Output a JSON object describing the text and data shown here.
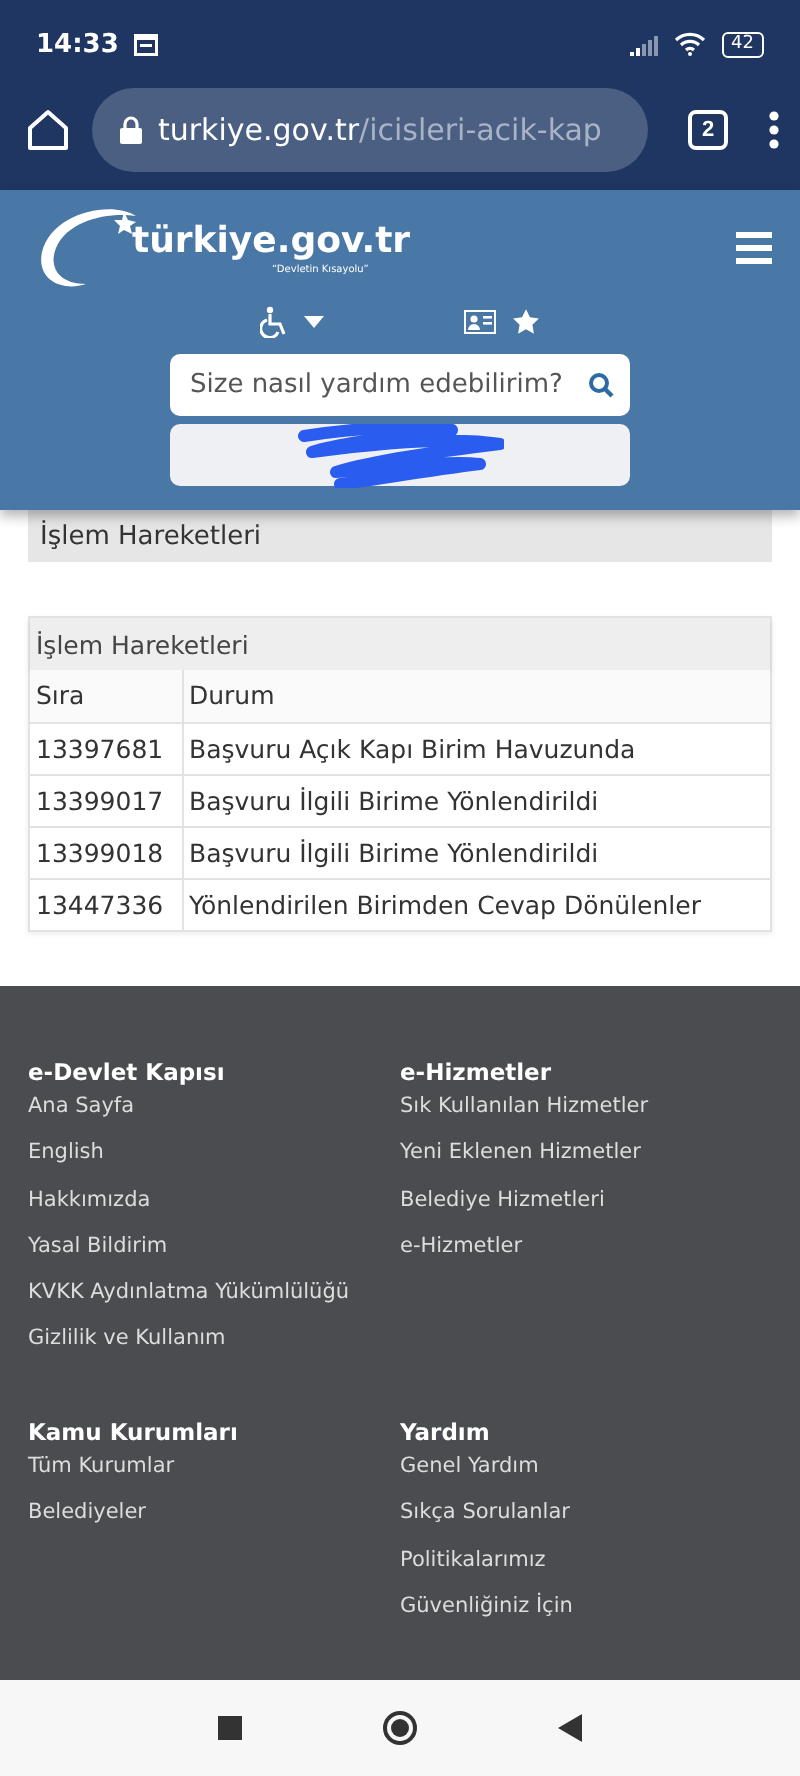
{
  "status_bar": {
    "time": "14:33",
    "battery": "42"
  },
  "browser": {
    "url_host": "turkiye.gov.tr",
    "url_path": "/icisleri-acik-kap",
    "tab_count": "2"
  },
  "application": {
    "panel_title": "İşlem Hareketleri"
  },
  "header": {
    "logo_text": "türkiye.gov.tr",
    "logo_tagline": "“Devletin Kısayolu”",
    "search": {
      "placeholder": "Size nasıl yardım edebilirim?"
    }
  },
  "table": {
    "title": "İşlem Hareketleri",
    "columns": [
      "Sıra",
      "Durum"
    ],
    "rows": [
      [
        "13397681",
        "Başvuru Açık Kapı Birim Havuzunda"
      ],
      [
        "13399017",
        "Başvuru İlgili Birime Yönlendirildi"
      ],
      [
        "13399018",
        "Başvuru İlgili Birime Yönlendirildi"
      ],
      [
        "13447336",
        "Yönlendirilen Birimden Cevap Dönülenler"
      ]
    ]
  },
  "footer": {
    "sections": [
      {
        "title": "e-Devlet Kapısı",
        "links": [
          "Ana Sayfa",
          "English",
          "Hakkımızda",
          "Yasal Bildirim",
          "KVKK Aydınlatma Yükümlülüğü",
          "Gizlilik ve Kullanım"
        ]
      },
      {
        "title": "e-Hizmetler",
        "links": [
          "Sık Kullanılan Hizmetler",
          "Yeni Eklenen Hizmetler",
          "Belediye Hizmetleri",
          "e-Hizmetler"
        ]
      },
      {
        "title": "Kamu Kurumları",
        "links": [
          "Tüm Kurumlar",
          "Belediyeler"
        ]
      },
      {
        "title": "Yardım",
        "links": [
          "Genel Yardım",
          "Sıkça Sorulanlar",
          "Politikalarımız",
          "Güvenliğiniz İçin"
        ]
      }
    ]
  }
}
